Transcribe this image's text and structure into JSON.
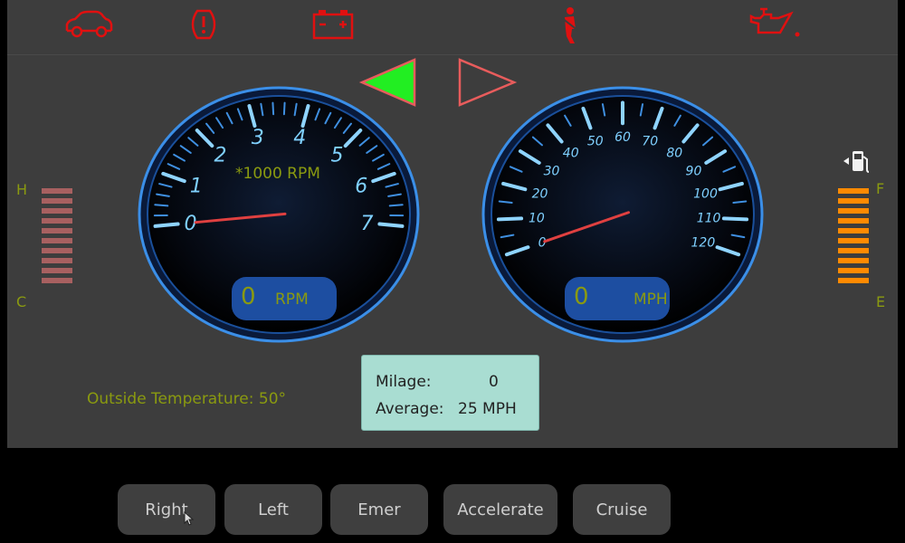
{
  "warning_lights": [
    {
      "icon": "car-icon",
      "color": "#e01010"
    },
    {
      "icon": "tire-pressure-icon",
      "color": "#e01010"
    },
    {
      "icon": "battery-icon",
      "color": "#e01010"
    },
    {
      "icon": "seatbelt-icon",
      "color": "#e01010"
    },
    {
      "icon": "oil-can-icon",
      "color": "#e01010"
    }
  ],
  "turn_signals": {
    "left": {
      "icon": "left-arrow-icon",
      "active": true,
      "fill": "#22ee22"
    },
    "right": {
      "icon": "right-arrow-icon",
      "active": false,
      "fill": "none"
    }
  },
  "tachometer": {
    "scale_label": "*1000 RPM",
    "ticks": [
      "0",
      "1",
      "2",
      "3",
      "4",
      "5",
      "6",
      "7"
    ],
    "value": "0",
    "unit": "RPM"
  },
  "speedometer": {
    "ticks": [
      "0",
      "10",
      "20",
      "30",
      "40",
      "50",
      "60",
      "70",
      "80",
      "90",
      "100",
      "110",
      "120"
    ],
    "value": "0",
    "unit": "MPH"
  },
  "temperature_meter": {
    "high_label": "H",
    "low_label": "C",
    "segments_total": 10,
    "segments_lit": 0
  },
  "fuel_meter": {
    "full_label": "F",
    "empty_label": "E",
    "segments_total": 10,
    "segments_lit": 10,
    "icon": "fuel-pump-icon"
  },
  "outside_temperature": "Outside Temperature: 50°",
  "trip": {
    "mileage_label": "Milage:",
    "mileage_value": "0",
    "average_label": "Average:",
    "average_value": "25 MPH"
  },
  "buttons": {
    "right": "Right",
    "left": "Left",
    "emer": "Emer",
    "accelerate": "Accelerate",
    "cruise": "Cruise"
  },
  "colors": {
    "warning_red": "#e01010",
    "label_olive": "#8a9a10",
    "gauge_blue": "#2a8cff",
    "needle_red": "#e04040",
    "fuel_orange": "#ff8a00",
    "temp_dim": "#a86060",
    "readout_blue": "#1d4ea1"
  }
}
